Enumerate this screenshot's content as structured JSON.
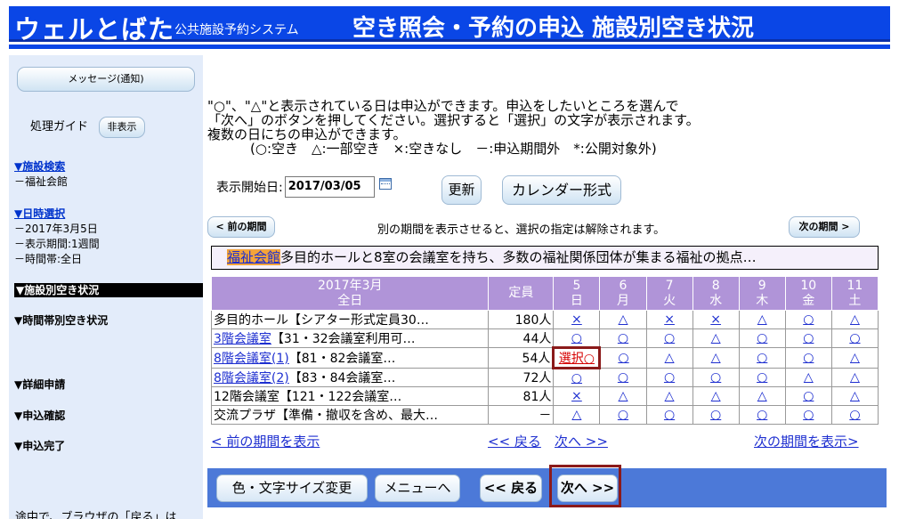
{
  "header": {
    "brand": "ウェルとばた",
    "system": "公共施設予約システム",
    "title": "空き照会・予約の申込 施設別空き状況"
  },
  "sidebar": {
    "message_button": "メッセージ(通知)",
    "guide_label": "処理ガイド",
    "guide_toggle": "非表示",
    "facility_search": "▼施設検索",
    "facility_value": "－福祉会館",
    "date_select": "▼日時選択",
    "date_lines": [
      "－2017年3月5日",
      "－表示期間:1週間",
      "－時間帯:全日"
    ],
    "active_step": "▼施設別空き状況",
    "steps": [
      "▼時間帯別空き状況",
      "▼詳細申請",
      "▼申込確認",
      "▼申込完了"
    ],
    "footer_cut": "途中で、ブラウザの「戻る」は"
  },
  "instructions": {
    "line1": "\"○\"、\"△\"と表示されている日は申込ができます。申込をしたいところを選んで",
    "line2": "「次へ」のボタンを押してください。選択すると「選択」の文字が表示されます。",
    "line3": "複数の日にちの申込ができます。",
    "legend": "(○:空き　△:一部空き　×:空きなし　－:申込期間外　*:公開対象外)"
  },
  "controls": {
    "start_date_label": "表示開始日:",
    "start_date_value": "2017/03/05",
    "update_button": "更新",
    "calendar_button": "カレンダー形式",
    "prev_period_button": "< 前の期間",
    "next_period_button": "次の期間 >",
    "period_note": "別の期間を表示させると、選択の指定は解除されます。"
  },
  "facility": {
    "name": "福祉会館",
    "description": "多目的ホールと8室の会議室を持ち、多数の福祉関係団体が集まる福祉の拠点…"
  },
  "table": {
    "header_month": "2017年3月",
    "header_time": "全日",
    "header_capacity": "定員",
    "days": [
      {
        "date": "5",
        "weekday": "日"
      },
      {
        "date": "6",
        "weekday": "月"
      },
      {
        "date": "7",
        "weekday": "火"
      },
      {
        "date": "8",
        "weekday": "水"
      },
      {
        "date": "9",
        "weekday": "木"
      },
      {
        "date": "10",
        "weekday": "金"
      },
      {
        "date": "11",
        "weekday": "土"
      }
    ],
    "rows": [
      {
        "name": "多目的ホール【シアター形式定員30…",
        "cap": "180人",
        "slots": [
          "×",
          "△",
          "×",
          "×",
          "△",
          "○",
          "△"
        ]
      },
      {
        "name_link": "3階会議室",
        "name_rest": "【31・32会議室利用可…",
        "cap": "44人",
        "slots": [
          "○",
          "○",
          "○",
          "△",
          "○",
          "○",
          "○"
        ]
      },
      {
        "name_link": "8階会議室(1)",
        "name_rest": "【81・82会議室…",
        "cap": "54人",
        "slots": [
          "選択○",
          "○",
          "△",
          "△",
          "○",
          "○",
          "△"
        ]
      },
      {
        "name_link": "8階会議室(2)",
        "name_rest": "【83・84会議室…",
        "cap": "72人",
        "slots": [
          "○",
          "○",
          "○",
          "○",
          "○",
          "△",
          "△"
        ]
      },
      {
        "name": "12階会議室【121・122会議室…",
        "cap": "81人",
        "slots": [
          "×",
          "△",
          "△",
          "△",
          "△",
          "○",
          "△"
        ]
      },
      {
        "name": "交流プラザ【準備・撤収を含め、最大…",
        "cap": "－",
        "slots": [
          "△",
          "○",
          "○",
          "○",
          "○",
          "○",
          "○"
        ]
      }
    ]
  },
  "pager": {
    "prev_period": "< 前の期間を表示",
    "back": "<< 戻る",
    "next": "次へ >>",
    "next_period": "次の期間を表示>"
  },
  "bottom": {
    "color_size": "色・文字サイズ変更",
    "menu": "メニューへ",
    "back": "<< 戻る",
    "next": "次へ >>"
  }
}
